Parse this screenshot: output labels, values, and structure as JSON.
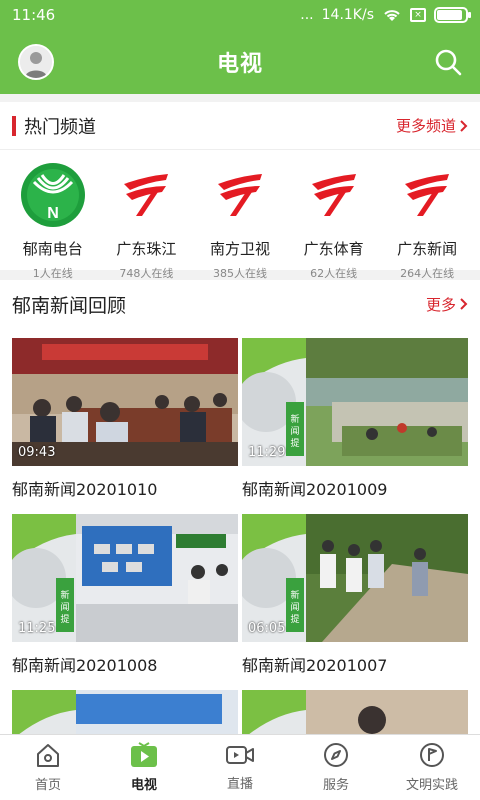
{
  "status": {
    "time": "11:46",
    "dots": "...",
    "speed": "14.1K/s",
    "battery_level": 0.9
  },
  "header": {
    "title": "电视",
    "avatar_icon": "user-avatar-icon",
    "search_icon": "search-icon"
  },
  "hot": {
    "title": "热门频道",
    "more": "更多频道",
    "channels": [
      {
        "name": "郁南电台",
        "count": "1人在线"
      },
      {
        "name": "广东珠江",
        "count": "748人在线"
      },
      {
        "name": "南方卫视",
        "count": "385人在线"
      },
      {
        "name": "广东体育",
        "count": "62人在线"
      },
      {
        "name": "广东新闻",
        "count": "264人在线"
      }
    ]
  },
  "news": {
    "title": "郁南新闻回顾",
    "more": "更多",
    "items": [
      {
        "title": "郁南新闻20201010",
        "duration": "09:43"
      },
      {
        "title": "郁南新闻20201009",
        "duration": "11:29"
      },
      {
        "title": "郁南新闻20201008",
        "duration": "11:25"
      },
      {
        "title": "郁南新闻20201007",
        "duration": "06:05"
      }
    ]
  },
  "tabs": [
    {
      "label": "首页"
    },
    {
      "label": "电视"
    },
    {
      "label": "直播"
    },
    {
      "label": "服务"
    },
    {
      "label": "文明实践"
    }
  ],
  "colors": {
    "brand": "#6cc04a",
    "accent": "#d8262e"
  }
}
